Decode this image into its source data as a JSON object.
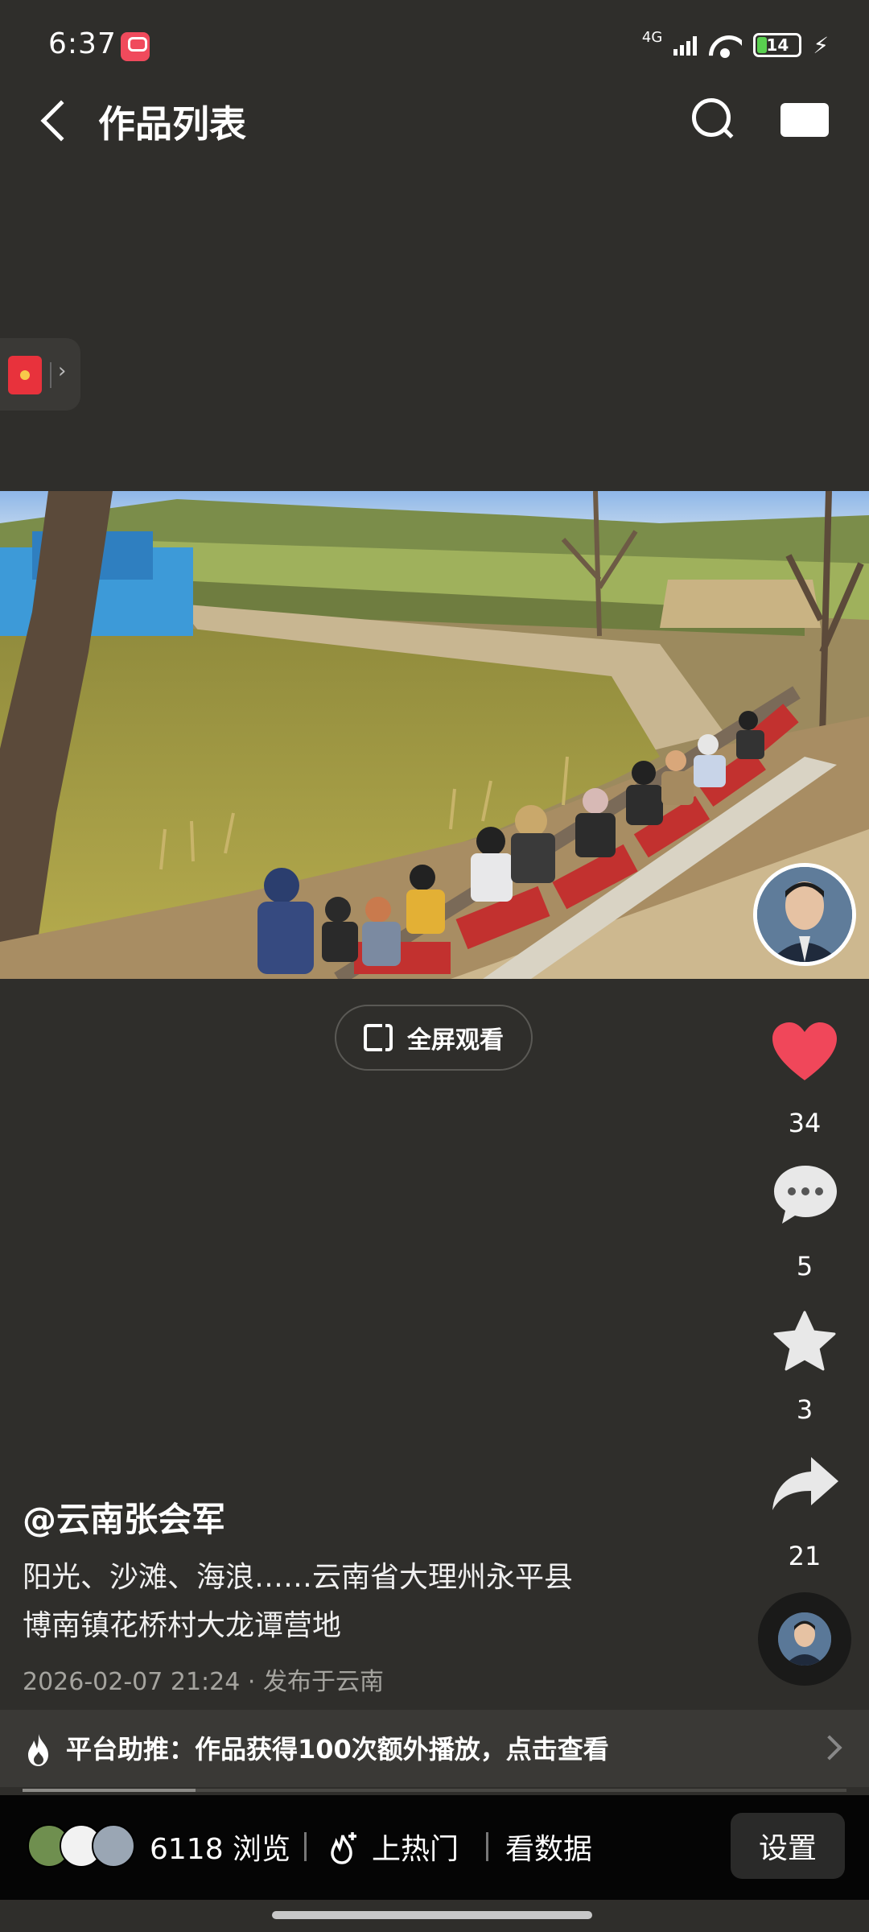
{
  "status_bar": {
    "time": "6:37",
    "network": "4G",
    "battery": "14",
    "icons": [
      "kuaishou-app-icon",
      "signal-icon",
      "wifi-icon",
      "battery-icon",
      "charging-icon"
    ]
  },
  "header": {
    "title": "作品列表",
    "icons": [
      "back-icon",
      "search-icon",
      "camera-icon"
    ]
  },
  "side_pill": {
    "icon": "red-packet-icon",
    "chevron": "›"
  },
  "video": {
    "fullscreen_label": "全屏观看"
  },
  "actions": {
    "likes": "34",
    "comments": "5",
    "favorites": "3",
    "shares": "21",
    "icons": [
      "heart-icon",
      "comment-icon",
      "star-icon",
      "share-icon"
    ],
    "heart_color": "#f0475a"
  },
  "post": {
    "author": "@云南张会军",
    "caption_line1": "阳光、沙滩、海浪……云南省大理州永平县",
    "caption_line2": "博南镇花桥村大龙谭营地",
    "meta": "2026-02-07 21:24 · 发布于云南"
  },
  "promo": {
    "text": "平台助推：作品获得100次额外播放，点击查看",
    "icon": "fire-icon",
    "progress": 0.21
  },
  "bottom_bar": {
    "views": "6118 浏览",
    "hot_label": "上热门",
    "data_label": "看数据",
    "settings_label": "设置"
  }
}
